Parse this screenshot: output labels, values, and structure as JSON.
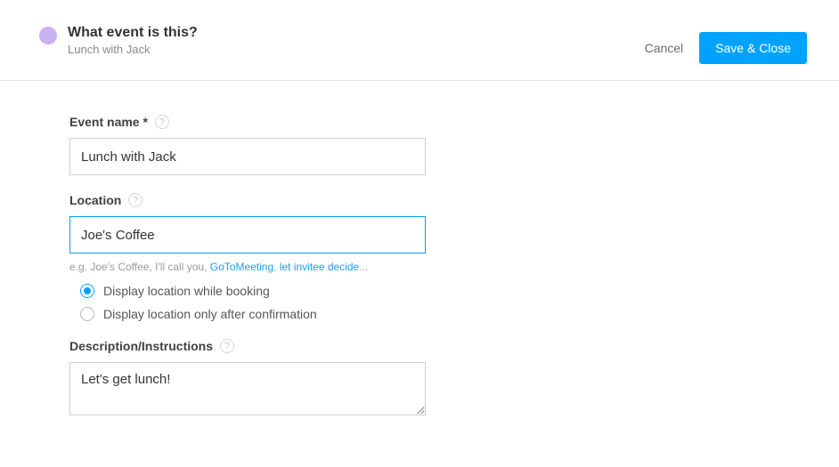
{
  "colors": {
    "accent": "#00a2ff",
    "dot": "#c9b3f2"
  },
  "header": {
    "title": "What event is this?",
    "subtitle": "Lunch with Jack",
    "cancel": "Cancel",
    "save": "Save & Close"
  },
  "event_name": {
    "label": "Event name",
    "required_marker": "*",
    "value": "Lunch with Jack"
  },
  "location": {
    "label": "Location",
    "value": "Joe's Coffee",
    "hint_prefix": "e.g. Joe's Coffee, I'll call you, ",
    "hint_link1": "GoToMeeting",
    "hint_sep": ", ",
    "hint_link2": "let invitee decide",
    "hint_suffix": "...",
    "options": [
      {
        "label": "Display location while booking",
        "selected": true
      },
      {
        "label": "Display location only after confirmation",
        "selected": false
      }
    ]
  },
  "description": {
    "label": "Description/Instructions",
    "value": "Let's get lunch!"
  }
}
